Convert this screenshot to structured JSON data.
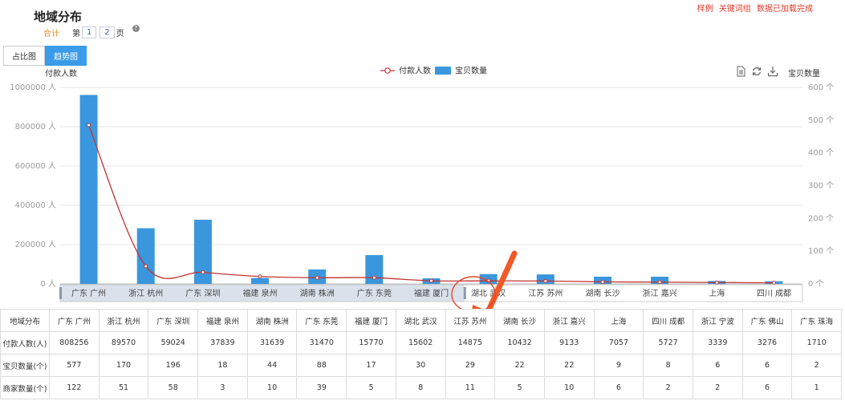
{
  "header": {
    "title": "地域分布",
    "links": [
      "样例",
      "关键词组",
      "数据已加载完成"
    ],
    "total_label": "合计",
    "page_prefix": "第",
    "pages": [
      "1",
      "2"
    ],
    "page_suffix": "页",
    "help": "?"
  },
  "tabs": [
    {
      "label": "占比图",
      "active": false
    },
    {
      "label": "趋势图",
      "active": true
    }
  ],
  "tools": [
    "document-icon",
    "refresh-icon",
    "download-icon"
  ],
  "colors": {
    "line": "#c23531",
    "bar": "#3a97dd",
    "accent": "#3a9be8"
  },
  "chart_data": {
    "type": "bar",
    "left_axis_title": "付款人数",
    "right_axis_title": "宝贝数量",
    "left_unit": "人",
    "right_unit": "个",
    "left_ylim": [
      0,
      1000000
    ],
    "right_ylim": [
      0,
      600
    ],
    "left_ticks": [
      0,
      200000,
      400000,
      600000,
      800000,
      1000000
    ],
    "right_ticks": [
      0,
      100,
      200,
      300,
      400,
      500,
      600
    ],
    "legend_position": "top-center",
    "grid": true,
    "categories": [
      "广东 广州",
      "浙江 杭州",
      "广东 深圳",
      "福建 泉州",
      "湖南 株洲",
      "广东 东莞",
      "福建 厦门",
      "湖北 武汉",
      "江苏 苏州",
      "湖南 长沙",
      "浙江 嘉兴",
      "上海",
      "四川 成都"
    ],
    "series": [
      {
        "name": "付款人数",
        "type": "line",
        "axis": "left",
        "values": [
          808256,
          89570,
          59024,
          37839,
          31639,
          31470,
          15770,
          15602,
          14875,
          10432,
          9133,
          7057,
          5727
        ]
      },
      {
        "name": "宝贝数量",
        "type": "bar",
        "axis": "right",
        "values": [
          577,
          170,
          196,
          18,
          44,
          88,
          17,
          30,
          29,
          22,
          22,
          9,
          8
        ]
      }
    ]
  },
  "table": {
    "rows": [
      [
        "地域分布",
        "广东 广州",
        "浙江 杭州",
        "广东 深圳",
        "福建 泉州",
        "湖南 株洲",
        "广东 东莞",
        "福建 厦门",
        "湖北 武汉",
        "江苏 苏州",
        "湖南 长沙",
        "浙江 嘉兴",
        "上海",
        "四川 成都",
        "浙江 宁波",
        "广东 佛山",
        "广东 珠海"
      ],
      [
        "付款人数(人)",
        "808256",
        "89570",
        "59024",
        "37839",
        "31639",
        "31470",
        "15770",
        "15602",
        "14875",
        "10432",
        "9133",
        "7057",
        "5727",
        "3339",
        "3276",
        "1710"
      ],
      [
        "宝贝数量(个)",
        "577",
        "170",
        "196",
        "18",
        "44",
        "88",
        "17",
        "30",
        "29",
        "22",
        "22",
        "9",
        "8",
        "6",
        "6",
        "2"
      ],
      [
        "商家数量(个)",
        "122",
        "51",
        "58",
        "3",
        "10",
        "39",
        "5",
        "8",
        "11",
        "5",
        "10",
        "6",
        "2",
        "2",
        "6",
        "1"
      ]
    ]
  }
}
